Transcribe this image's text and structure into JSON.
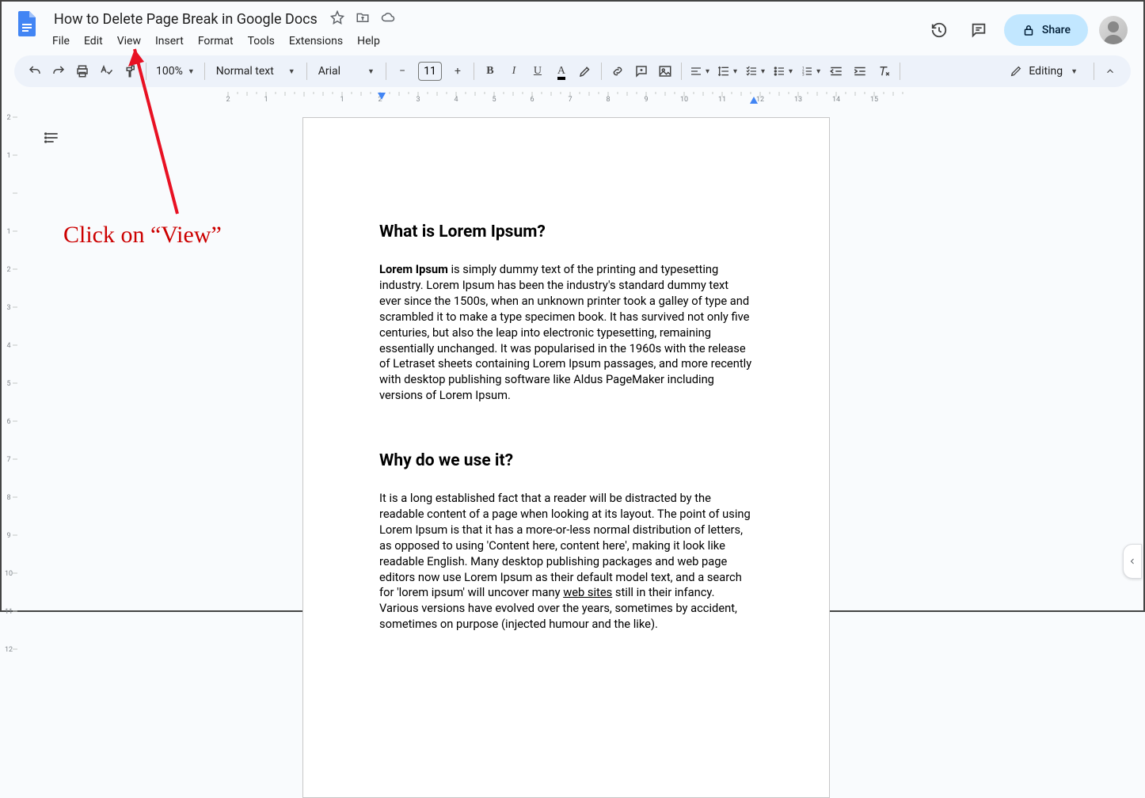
{
  "doc": {
    "title": "How to Delete Page Break in Google Docs"
  },
  "menu": {
    "file": "File",
    "edit": "Edit",
    "view": "View",
    "insert": "Insert",
    "format": "Format",
    "tools": "Tools",
    "extensions": "Extensions",
    "help": "Help"
  },
  "share": {
    "label": "Share"
  },
  "toolbar": {
    "zoom": "100%",
    "style": "Normal text",
    "font": "Arial",
    "fontsize": "11",
    "editing": "Editing"
  },
  "content": {
    "h1": "What is Lorem Ipsum?",
    "p1_bold": "Lorem Ipsum",
    "p1_rest": " is simply dummy text of the printing and typesetting industry. Lorem Ipsum has been the industry's standard dummy text ever since the 1500s, when an unknown printer took a galley of type and scrambled it to make a type specimen book. It has survived not only five centuries, but also the leap into electronic typesetting, remaining essentially unchanged. It was popularised in the 1960s with the release of Letraset sheets containing Lorem Ipsum passages, and more recently with desktop publishing software like Aldus PageMaker including versions of Lorem Ipsum.",
    "h2": "Why do we use it?",
    "p2a": "It is a long established fact that a reader will be distracted by the readable content of a page when looking at its layout. The point of using Lorem Ipsum is that it has a more-or-less normal distribution of letters, as opposed to using 'Content here, content here', making it look like readable English. Many desktop publishing packages and web page editors now use Lorem Ipsum as their default model text, and a search for 'lorem ipsum' will uncover many ",
    "p2_link": "web sites",
    "p2b": " still in their infancy. Various versions have evolved over the years, sometimes by accident, sometimes on purpose (injected humour and the like)."
  },
  "annotation": {
    "text": "Click on “View”"
  },
  "ruler": {
    "nums": [
      "2",
      "1",
      "1",
      "2",
      "3",
      "4",
      "5",
      "6",
      "7",
      "8",
      "9",
      "10",
      "11",
      "12",
      "13",
      "14",
      "15"
    ]
  }
}
